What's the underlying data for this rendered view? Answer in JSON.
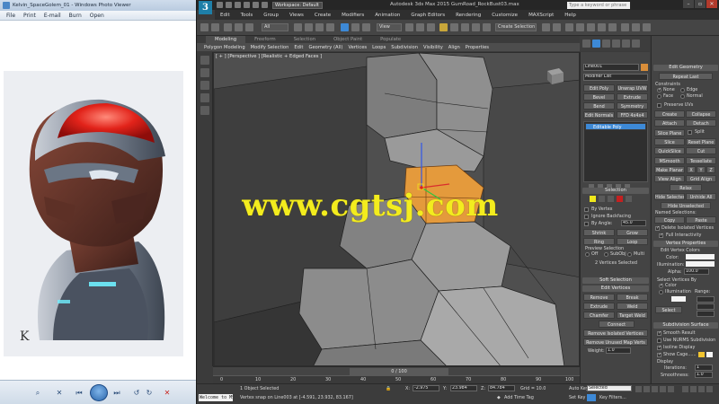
{
  "photo_viewer": {
    "title": "Kelvin_SpaceGolem_01 - Windows Photo Viewer",
    "menu": [
      "File",
      "Print",
      "E-mail",
      "Burn",
      "Open"
    ]
  },
  "max": {
    "title": "Autodesk 3ds Max 2015    GumRoad_RockBust03.max",
    "logo": "3",
    "workspace": "Workspace: Default",
    "search_placeholder": "Type a keyword or phrase",
    "menu": [
      "Edit",
      "Tools",
      "Group",
      "Views",
      "Create",
      "Modifiers",
      "Animation",
      "Graph Editors",
      "Rendering",
      "Customize",
      "MAXScript",
      "Help"
    ],
    "toolbar": {
      "filter": "All",
      "view": "View",
      "selection_set": "Create Selection Set"
    },
    "ribbon_tabs": [
      "Modeling",
      "Freeform",
      "Selection",
      "Object Paint",
      "Populate"
    ],
    "ribbon_active_tab": "Modeling",
    "ribbon_sub": [
      "Polygon Modeling",
      "Modify Selection",
      "Edit",
      "Geometry (All)",
      "Vertices",
      "Loops",
      "Subdivision",
      "Visibility",
      "Align",
      "Properties"
    ],
    "viewport_label": "[ + ] [Perspective ] [Realistic + Edged Faces ]",
    "watermark": "www.cgtsj.com"
  },
  "command_panel": {
    "object_name": "Line001",
    "modifier_list": "Modifier List",
    "buttons_top": [
      [
        "Edit Poly",
        "Unwrap UVW"
      ],
      [
        "Bevel",
        "Extrude"
      ],
      [
        "Bend",
        "Symmetry"
      ],
      [
        "Edit Normals",
        "FFD 4x4x4"
      ]
    ],
    "stack_item": "Editable Poly",
    "selection": {
      "title": "Selection",
      "by_vertex": "By Vertex",
      "ignore_backfacing": "Ignore Backfacing",
      "by_angle": "By Angle:",
      "by_angle_value": "45.0",
      "shrink": "Shrink",
      "grow": "Grow",
      "ring": "Ring",
      "loop": "Loop",
      "preview": "Preview Selection",
      "off": "Off",
      "subobj": "SubObj",
      "multi": "Multi",
      "status": "2 Vertices Selected"
    },
    "soft_selection": "Soft Selection",
    "edit_vertices": {
      "title": "Edit Vertices",
      "remove": "Remove",
      "break": "Break",
      "extrude": "Extrude",
      "weld": "Weld",
      "chamfer": "Chamfer",
      "target_weld": "Target Weld",
      "connect": "Connect",
      "remove_isolated": "Remove Isolated Vertices",
      "remove_unused": "Remove Unused Map Verts",
      "weight": "Weight:",
      "weight_value": "1.0"
    }
  },
  "right_panel": {
    "edit_geometry": "Edit Geometry",
    "repeat_last": "Repeat Last",
    "constraints": "Constraints",
    "none": "None",
    "edge": "Edge",
    "face": "Face",
    "normal": "Normal",
    "preserve_uvs": "Preserve UVs",
    "create": "Create",
    "collapse": "Collapse",
    "attach": "Attach",
    "detach": "Detach",
    "slice_plane": "Slice Plane",
    "split": "Split",
    "slice": "Slice",
    "reset_plane": "Reset Plane",
    "quickslice": "QuickSlice",
    "cut": "Cut",
    "msmooth": "MSmooth",
    "tessellate": "Tessellate",
    "make_planar": "Make Planar",
    "x": "X",
    "y": "Y",
    "z": "Z",
    "view_align": "View Align",
    "grid_align": "Grid Align",
    "relax": "Relax",
    "hide_selected": "Hide Selected",
    "unhide_all": "Unhide All",
    "hide_unselected": "Hide Unselected",
    "named_selections": "Named Selections:",
    "copy": "Copy",
    "paste": "Paste",
    "delete_isolated": "Delete Isolated Vertices",
    "full_interactivity": "Full Interactivity",
    "vertex_properties": "Vertex Properties",
    "edit_vertex_colors": "Edit Vertex Colors",
    "color": "Color:",
    "illumination": "Illumination:",
    "alpha": "Alpha:",
    "alpha_value": "100.0",
    "select_vertices_by": "Select Vertices By",
    "sv_color": "Color",
    "sv_illumination": "Illumination",
    "range": "Range:",
    "select": "Select",
    "subdivision_surface": "Subdivision Surface",
    "smooth_result": "Smooth Result",
    "use_nurms": "Use NURMS Subdivision",
    "isoline": "Isoline Display",
    "show_cage": "Show Cage......",
    "display": "Display",
    "iterations": "Iterations:",
    "iterations_value": "1",
    "smoothness": "Smoothness:",
    "smoothness_value": "1.0"
  },
  "timeline": {
    "slider": "0 / 100",
    "ticks": [
      "0",
      "10",
      "20",
      "30",
      "40",
      "50",
      "60",
      "70",
      "80",
      "90",
      "100"
    ]
  },
  "status": {
    "maxscript": "Welcome to MS",
    "objects": "1 Object Selected",
    "prompt": "Vertex snap on Line003 at [-4.591, 23.932, 83.167]",
    "x": "-2.975",
    "y": "23.984",
    "z": "84.784",
    "grid": "Grid = 10.0",
    "add_time_tag": "Add Time Tag",
    "auto_key": "Auto Key",
    "selected": "Selected",
    "set_key": "Set Key",
    "key_filters": "Key Filters..."
  }
}
